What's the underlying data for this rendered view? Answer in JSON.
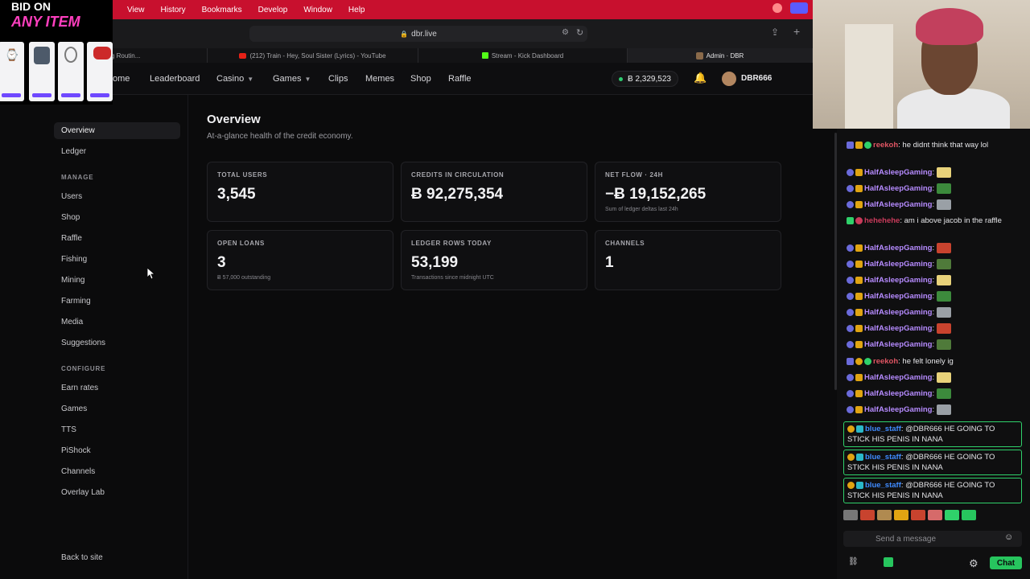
{
  "overlay": {
    "bid_line1": "BID ON",
    "bid_line2": "ANY ITEM"
  },
  "menubar": {
    "items": [
      "View",
      "History",
      "Bookmarks",
      "Develop",
      "Window",
      "Help"
    ]
  },
  "browser": {
    "url": "dbr.live",
    "tabs": [
      {
        "label": "g's 4AM Morning Routin..."
      },
      {
        "label": "(212) Train - Hey, Soul Sister (Lyrics) - YouTube"
      },
      {
        "label": "Stream - Kick Dashboard"
      },
      {
        "label": "Admin · DBR"
      }
    ]
  },
  "header": {
    "nav": [
      "ome",
      "Leaderboard",
      "Casino",
      "Games",
      "Clips",
      "Memes",
      "Shop",
      "Raffle"
    ],
    "balance": "Ƀ 2,329,523",
    "username": "DBR666"
  },
  "sidebar": {
    "overview": "Overview",
    "ledger": "Ledger",
    "manage_heading": "MANAGE",
    "manage": [
      "Users",
      "Shop",
      "Raffle",
      "Fishing",
      "Mining",
      "Farming",
      "Media",
      "Suggestions"
    ],
    "configure_heading": "CONFIGURE",
    "configure": [
      "Earn rates",
      "Games",
      "TTS",
      "PiShock",
      "Channels",
      "Overlay Lab"
    ],
    "back": "Back to site"
  },
  "main": {
    "title": "Overview",
    "subtitle": "At-a-glance health of the credit economy.",
    "cards": [
      {
        "label": "TOTAL USERS",
        "value": "3,545",
        "sub": ""
      },
      {
        "label": "CREDITS IN CIRCULATION",
        "value": "Ƀ 92,275,354",
        "sub": ""
      },
      {
        "label": "NET FLOW · 24H",
        "value": "−Ƀ 19,152,265",
        "sub": "Sum of ledger deltas last 24h"
      },
      {
        "label": "OPEN LOANS",
        "value": "3",
        "sub": "Ƀ 57,000 outstanding"
      },
      {
        "label": "LEDGER ROWS TODAY",
        "value": "53,199",
        "sub": "Transactions since midnight UTC"
      },
      {
        "label": "CHANNELS",
        "value": "1",
        "sub": ""
      }
    ]
  },
  "chat": {
    "messages": [
      {
        "user": "reekoh",
        "text": ": he didnt think that way lol"
      },
      {
        "user": "HalfAsleepGaming",
        "text": ":"
      },
      {
        "user": "HalfAsleepGaming",
        "text": ":"
      },
      {
        "user": "HalfAsleepGaming",
        "text": ":"
      },
      {
        "user": "hehehehe",
        "text": ": am i above jacob in the raffle"
      },
      {
        "user": "HalfAsleepGaming",
        "text": ":"
      },
      {
        "user": "HalfAsleepGaming",
        "text": ":"
      },
      {
        "user": "HalfAsleepGaming",
        "text": ":"
      },
      {
        "user": "HalfAsleepGaming",
        "text": ":"
      },
      {
        "user": "HalfAsleepGaming",
        "text": ":"
      },
      {
        "user": "HalfAsleepGaming",
        "text": ":"
      },
      {
        "user": "HalfAsleepGaming",
        "text": ":"
      },
      {
        "user": "reekoh",
        "text": ": he felt lonely ig"
      },
      {
        "user": "HalfAsleepGaming",
        "text": ":"
      },
      {
        "user": "HalfAsleepGaming",
        "text": ":"
      },
      {
        "user": "HalfAsleepGaming",
        "text": ":"
      }
    ],
    "highlights": [
      {
        "user": "blue_staff",
        "text": ": @DBR666 HE GOING TO STICK HIS PENIS IN NANA"
      },
      {
        "user": "blue_staff",
        "text": ": @DBR666 HE GOING TO STICK HIS PENIS IN NANA"
      },
      {
        "user": "blue_staff",
        "text": ": @DBR666 HE GOING TO STICK HIS PENIS IN NANA"
      }
    ],
    "placeholder": "Send a message",
    "button": "Chat"
  },
  "colors": {
    "accent_green": "#27c55e",
    "menubar_red": "#c8102e",
    "overlay_pink": "#ff3fbf"
  }
}
